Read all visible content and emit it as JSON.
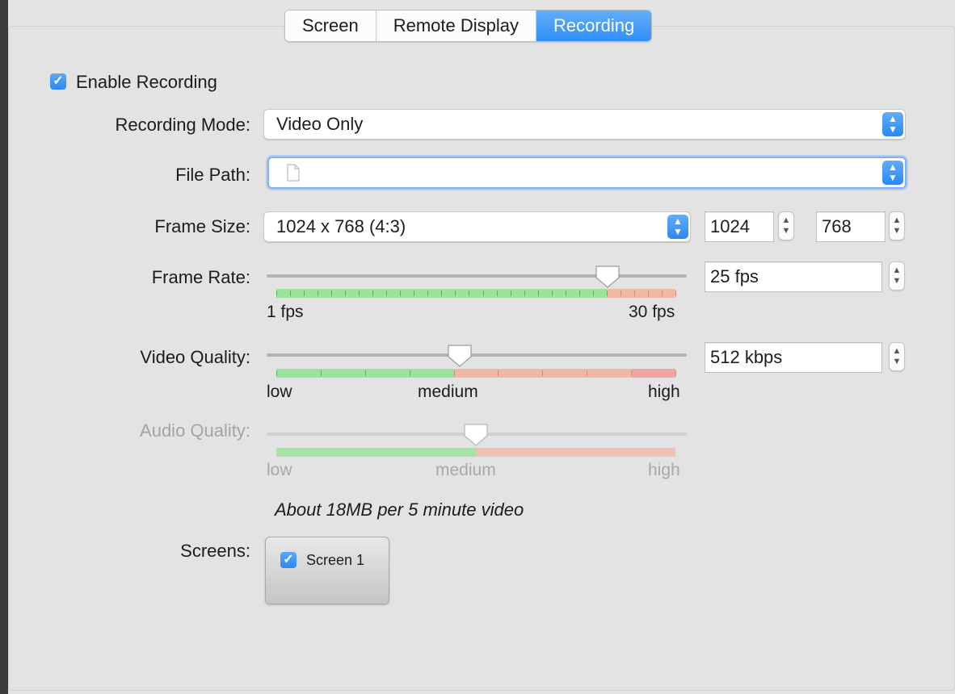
{
  "tabs": [
    {
      "label": "Screen",
      "active": false
    },
    {
      "label": "Remote Display",
      "active": false
    },
    {
      "label": "Recording",
      "active": true
    }
  ],
  "enable_recording": {
    "label": "Enable Recording",
    "checked": true
  },
  "recording_mode": {
    "label": "Recording Mode:",
    "value": "Video Only"
  },
  "file_path": {
    "label": "File Path:",
    "value": ""
  },
  "frame_size": {
    "label": "Frame Size:",
    "value": "1024 x 768 (4:3)",
    "width": "1024",
    "height": "768"
  },
  "frame_rate": {
    "label": "Frame Rate:",
    "value": "25 fps",
    "min_label": "1 fps",
    "max_label": "30 fps",
    "level": 0.83
  },
  "video_quality": {
    "label": "Video Quality:",
    "value": "512 kbps",
    "low": "low",
    "mid": "medium",
    "high": "high",
    "level": 0.46
  },
  "audio_quality": {
    "label": "Audio Quality:",
    "low": "low",
    "mid": "medium",
    "high": "high",
    "level": 0.5,
    "enabled": false
  },
  "estimate": "About 18MB per 5 minute video",
  "screens": {
    "label": "Screens:",
    "items": [
      {
        "label": "Screen 1",
        "checked": true
      }
    ]
  },
  "colors": {
    "accent": "#2f8ef7",
    "good": "#9ae39a",
    "bad": "#f2b8a6",
    "worst": "#f0a3a3"
  }
}
